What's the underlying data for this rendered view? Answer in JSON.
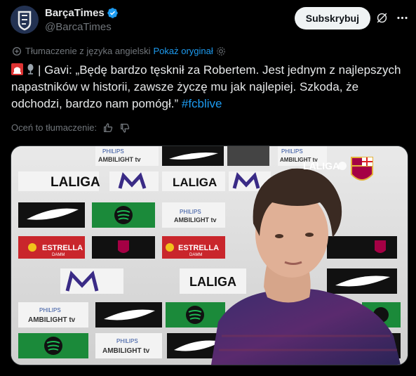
{
  "account": {
    "display_name": "BarçaTimes",
    "handle": "@BarcaTimes",
    "subscribe_label": "Subskrybuj"
  },
  "translation": {
    "notice": "Tłumaczenie z języka angielski",
    "show_original": "Pokaż oryginał"
  },
  "tweet": {
    "text": "| Gavi: „Będę bardzo tęsknił za Robertem. Jest jednym z najlepszych napastników w historii, zawsze życzę mu jak najlepiej. Szkoda, że odchodzi, bardzo nam pomógł.” ",
    "hashtag": "#fcblive"
  },
  "rating": {
    "label": "Oceń to tłumaczenie:"
  },
  "media": {
    "board_texts": {
      "laliga": "LALIGA",
      "philips": "PHILIPS",
      "ambilight": "AMBILIGHT tv",
      "estrella": "ESTRELLA",
      "damm": "DAMM"
    },
    "overlay_logo": "LALIGA"
  },
  "colors": {
    "background": "#000000",
    "text": "#e7e9ea",
    "muted": "#71767b",
    "accent": "#1d9bf0",
    "verified": "#1d9bf0"
  }
}
